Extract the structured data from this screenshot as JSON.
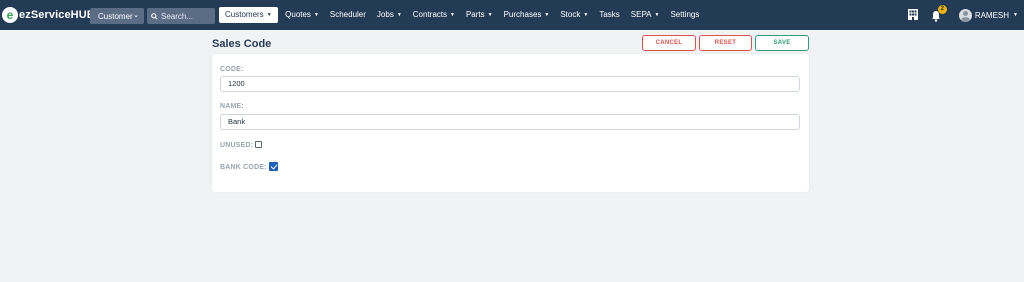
{
  "brand": {
    "logo_letter": "e",
    "name": "ezServiceHUB"
  },
  "nav": {
    "scope_select": "Customer",
    "search_placeholder": "Search...",
    "items": [
      {
        "label": "Customers",
        "has_caret": true,
        "active": true
      },
      {
        "label": "Quotes",
        "has_caret": true
      },
      {
        "label": "Scheduler",
        "has_caret": false
      },
      {
        "label": "Jobs",
        "has_caret": true
      },
      {
        "label": "Contracts",
        "has_caret": true
      },
      {
        "label": "Parts",
        "has_caret": true
      },
      {
        "label": "Purchases",
        "has_caret": true
      },
      {
        "label": "Stock",
        "has_caret": true
      },
      {
        "label": "Tasks",
        "has_caret": false
      },
      {
        "label": "SEPA",
        "has_caret": true
      },
      {
        "label": "Settings",
        "has_caret": false
      }
    ],
    "notification_count": "2",
    "user_name": "RAMESH"
  },
  "page": {
    "title": "Sales Code",
    "cancel_label": "CANCEL",
    "reset_label": "RESET",
    "save_label": "SAVE"
  },
  "form": {
    "code_label": "CODE:",
    "code_value": "1200",
    "name_label": "NAME:",
    "name_value": "Bank",
    "unused_label": "UNUSED:",
    "unused_checked": false,
    "bank_code_label": "BANK CODE:",
    "bank_code_checked": true
  },
  "colors": {
    "navbar": "#243b55",
    "danger": "#d9534f",
    "success": "#2e9a76",
    "checkbox_accent": "#1b5fb8"
  }
}
